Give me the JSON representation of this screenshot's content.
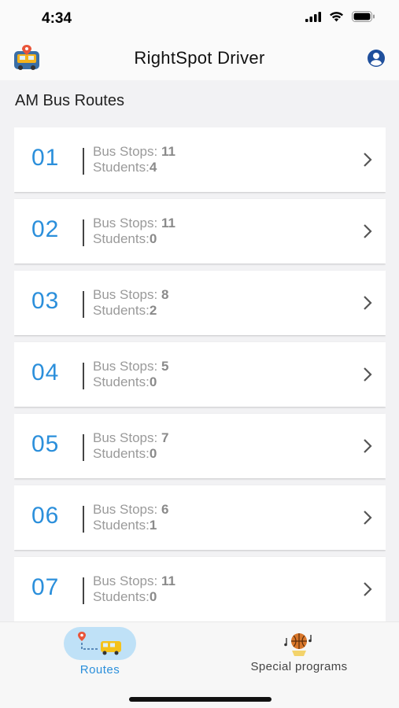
{
  "status_bar": {
    "time": "4:34"
  },
  "header": {
    "title": "RightSpot Driver"
  },
  "section": {
    "title": "AM Bus Routes"
  },
  "routes": [
    {
      "number": "01",
      "stops_label": "Bus Stops:",
      "stops": "11",
      "students_label": "Students:",
      "students": "4"
    },
    {
      "number": "02",
      "stops_label": "Bus Stops:",
      "stops": "11",
      "students_label": "Students:",
      "students": "0"
    },
    {
      "number": "03",
      "stops_label": "Bus Stops:",
      "stops": "8",
      "students_label": "Students:",
      "students": "2"
    },
    {
      "number": "04",
      "stops_label": "Bus Stops:",
      "stops": "5",
      "students_label": "Students:",
      "students": "0"
    },
    {
      "number": "05",
      "stops_label": "Bus Stops:",
      "stops": "7",
      "students_label": "Students:",
      "students": "0"
    },
    {
      "number": "06",
      "stops_label": "Bus Stops:",
      "stops": "6",
      "students_label": "Students:",
      "students": "1"
    },
    {
      "number": "07",
      "stops_label": "Bus Stops:",
      "stops": "11",
      "students_label": "Students:",
      "students": "0"
    }
  ],
  "tabs": [
    {
      "label": "Routes",
      "icon": "bus-route-icon",
      "active": true
    },
    {
      "label": "Special programs",
      "icon": "special-programs-icon",
      "active": false
    }
  ],
  "colors": {
    "accent": "#2b8fdb",
    "active_tab_bg": "#bfe1f7"
  }
}
